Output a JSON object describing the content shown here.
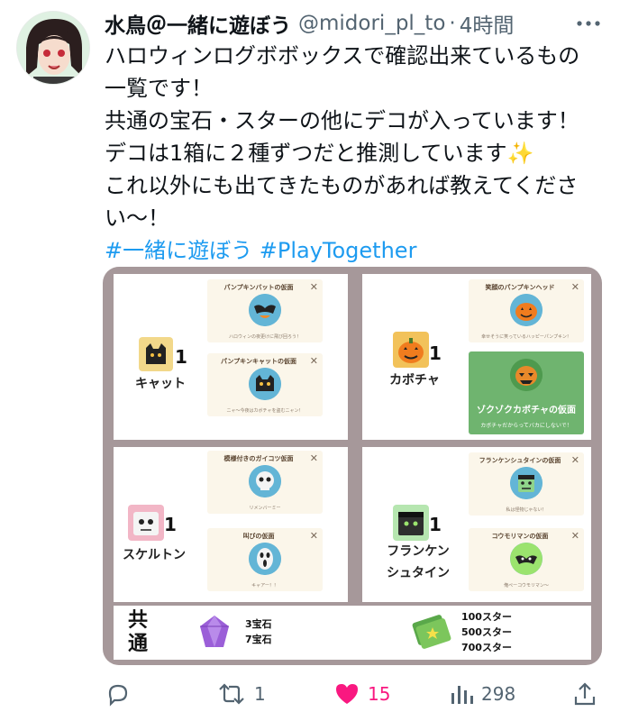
{
  "tweet": {
    "author_name": "水鳥＠一緒に遊ぼう",
    "handle": "@midori_pl_to",
    "separator": "·",
    "time": "4時間",
    "lines": [
      "ハロウィンログボボックスで確認出来ているもの",
      "一覧です！",
      "共通の宝石・スターの他にデコが入っています！",
      "デコは1箱に２種ずつだと推測しています✨",
      "これ以外にも出てきたものがあれば教えてくださ",
      "い〜！"
    ],
    "hashtags": [
      "#一緒に遊ぼう",
      "#PlayTogether"
    ]
  },
  "media": {
    "panels": [
      {
        "label": "キャット",
        "count": "1",
        "box_color": "#f2d88a",
        "cards": [
          {
            "title": "パンプキンバットの仮面",
            "desc": "ハロウィンの夜更けに飛び回ろう！",
            "close": "✕"
          },
          {
            "title": "パンプキンキャットの仮面",
            "desc": "ニャ〜今夜はカボチャを盗むニャン！",
            "close": "✕"
          }
        ]
      },
      {
        "label": "カボチャ",
        "count": "1",
        "box_color": "#f4b84a",
        "cards": [
          {
            "title": "笑顔のパンプキンヘッド",
            "desc": "幸せそうに笑っているハッピーパンプキン！",
            "close": "✕"
          },
          {
            "title": "ゾクゾクカボチャの仮面",
            "desc": "カボチャだからってバカにしないで！",
            "close": ""
          }
        ]
      },
      {
        "label": "スケルトン",
        "count": "1",
        "box_color": "#f2b6c6",
        "cards": [
          {
            "title": "模様付きのガイコツ仮面",
            "desc": "リメンバーミー",
            "close": "✕"
          },
          {
            "title": "叫びの仮面",
            "desc": "キャアー！！",
            "close": "✕"
          }
        ]
      },
      {
        "label_lines": [
          "フランケン",
          "シュタイン"
        ],
        "count": "1",
        "box_color": "#b6e6b0",
        "cards": [
          {
            "title": "フランケンシュタインの仮面",
            "desc": "私は怪物じゃない！",
            "close": "✕"
          },
          {
            "title": "コウモリマンの仮面",
            "desc": "俺ぺーコウモリマン〜",
            "close": "✕"
          }
        ]
      }
    ],
    "common": {
      "label_lines": [
        "共",
        "通"
      ],
      "gems": [
        "3宝石",
        "7宝石"
      ],
      "stars": [
        "100スター",
        "500スター",
        "700スター"
      ]
    }
  },
  "actions": {
    "replies": "",
    "retweets": "1",
    "likes": "15",
    "views": "298"
  },
  "colors": {
    "text": "#0f1419",
    "secondary": "#536471",
    "link": "#1d9bf0",
    "like": "#f91880",
    "media_frame": "#a6989a"
  }
}
